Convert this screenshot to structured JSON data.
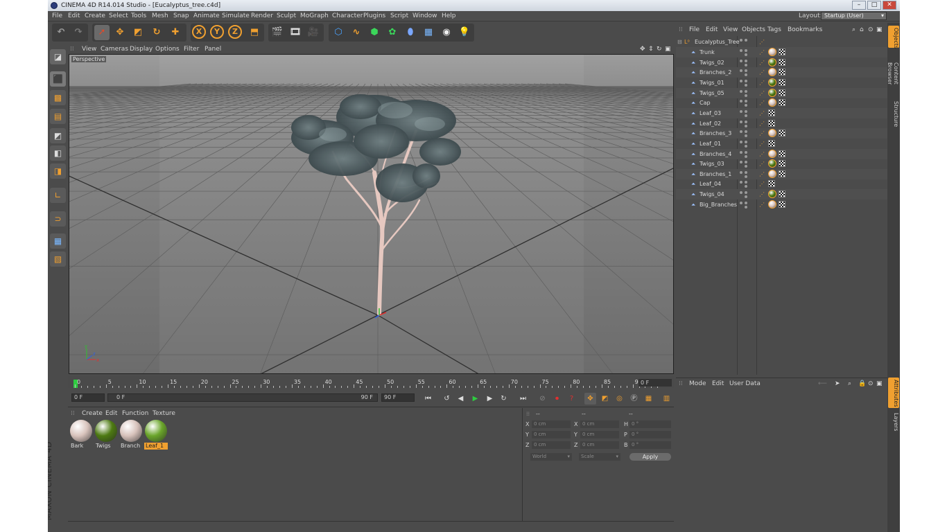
{
  "window": {
    "title": "CINEMA 4D R14.014 Studio - [Eucalyptus_tree.c4d]",
    "min": "–",
    "max": "□",
    "close": "✕"
  },
  "menubar": {
    "items": [
      "File",
      "Edit",
      "Create",
      "Select",
      "Tools",
      "Mesh",
      "Snap",
      "Animate",
      "Simulate",
      "Render",
      "Sculpt",
      "MoGraph",
      "Character",
      "Plugins",
      "Script",
      "Window",
      "Help"
    ],
    "layout_label": "Layout:",
    "layout_value": "Startup (User)"
  },
  "toolbar": {
    "icons": [
      "undo-icon",
      "redo-icon",
      "live-selection-icon",
      "move-icon",
      "scale-icon",
      "rotate-icon",
      "add-object-icon",
      "x-axis-icon",
      "y-axis-icon",
      "z-axis-icon",
      "coordinate-system-icon",
      "render-view-icon",
      "render-picture-viewer-icon",
      "render-settings-icon",
      "cube-icon",
      "spline-icon",
      "nurbs-icon",
      "array-icon",
      "deformer-icon",
      "floor-icon",
      "camera-icon",
      "light-icon"
    ],
    "axis_x": "X",
    "axis_y": "Y",
    "axis_z": "Z"
  },
  "viewport": {
    "menu": [
      "View",
      "Cameras",
      "Display",
      "Options",
      "Filter",
      "Panel"
    ],
    "label": "Perspective",
    "axes": {
      "x": "x",
      "y": "y",
      "z": "z"
    }
  },
  "timeline": {
    "ticks": [
      "0",
      "5",
      "10",
      "15",
      "20",
      "25",
      "30",
      "35",
      "40",
      "45",
      "50",
      "55",
      "60",
      "65",
      "70",
      "75",
      "80",
      "85",
      "90"
    ],
    "current_frame": "0 F"
  },
  "transport": {
    "start": "0 F",
    "slider_start": "0 F",
    "slider_end": "90 F",
    "end": "90 F"
  },
  "material_manager": {
    "menu": [
      "Create",
      "Edit",
      "Function",
      "Texture"
    ],
    "materials": [
      {
        "name": "Bark",
        "color": "#d9c4bd",
        "selected": false
      },
      {
        "name": "Twigs",
        "color": "#4d7a12",
        "selected": false
      },
      {
        "name": "Branch",
        "color": "#d7c2bb",
        "selected": false
      },
      {
        "name": "Leaf_1",
        "color": "#6aa52a",
        "selected": true
      }
    ]
  },
  "coordinates": {
    "header": [
      "--",
      "--",
      "--"
    ],
    "rows": [
      {
        "a1": "X",
        "v1": "0 cm",
        "a2": "X",
        "v2": "0 cm",
        "a3": "H",
        "v3": "0 °"
      },
      {
        "a1": "Y",
        "v1": "0 cm",
        "a2": "Y",
        "v2": "0 cm",
        "a3": "P",
        "v3": "0 °"
      },
      {
        "a1": "Z",
        "v1": "0 cm",
        "a2": "Z",
        "v2": "0 cm",
        "a3": "B",
        "v3": "0 °"
      }
    ],
    "mode": "World",
    "kind": "Scale",
    "apply": "Apply"
  },
  "object_manager": {
    "menu": [
      "File",
      "Edit",
      "View",
      "Objects",
      "Tags",
      "Bookmarks"
    ],
    "root": "Eucalyptus_Tree",
    "objects": [
      {
        "name": "Trunk",
        "material": "bark"
      },
      {
        "name": "Twigs_02",
        "material": "twigs"
      },
      {
        "name": "Branches_2",
        "material": "bark"
      },
      {
        "name": "Twigs_01",
        "material": "twigs"
      },
      {
        "name": "Twigs_05",
        "material": "twigs"
      },
      {
        "name": "Cap",
        "material": "bark"
      },
      {
        "name": "Leaf_03",
        "material": "none"
      },
      {
        "name": "Leaf_02",
        "material": "none"
      },
      {
        "name": "Branches_3",
        "material": "bark"
      },
      {
        "name": "Leaf_01",
        "material": "none"
      },
      {
        "name": "Branches_4",
        "material": "bark"
      },
      {
        "name": "Twigs_03",
        "material": "twigs"
      },
      {
        "name": "Branches_1",
        "material": "bark"
      },
      {
        "name": "Leaf_04",
        "material": "none"
      },
      {
        "name": "Twigs_04",
        "material": "twigs"
      },
      {
        "name": "Big_Branches",
        "material": "bark"
      }
    ]
  },
  "attribute_manager": {
    "menu": [
      "Mode",
      "Edit",
      "User Data"
    ]
  },
  "right_tabs": {
    "top": [
      "Objects",
      "Content Browser",
      "Structure"
    ],
    "bottom": [
      "Attributes",
      "Layers"
    ]
  },
  "brand": {
    "maxon": "MAXON",
    "product": "CINEMA 4D"
  },
  "colors": {
    "accent": "#f0a030",
    "panel": "#4b4b4b",
    "viewport": "#8e8e8e"
  }
}
